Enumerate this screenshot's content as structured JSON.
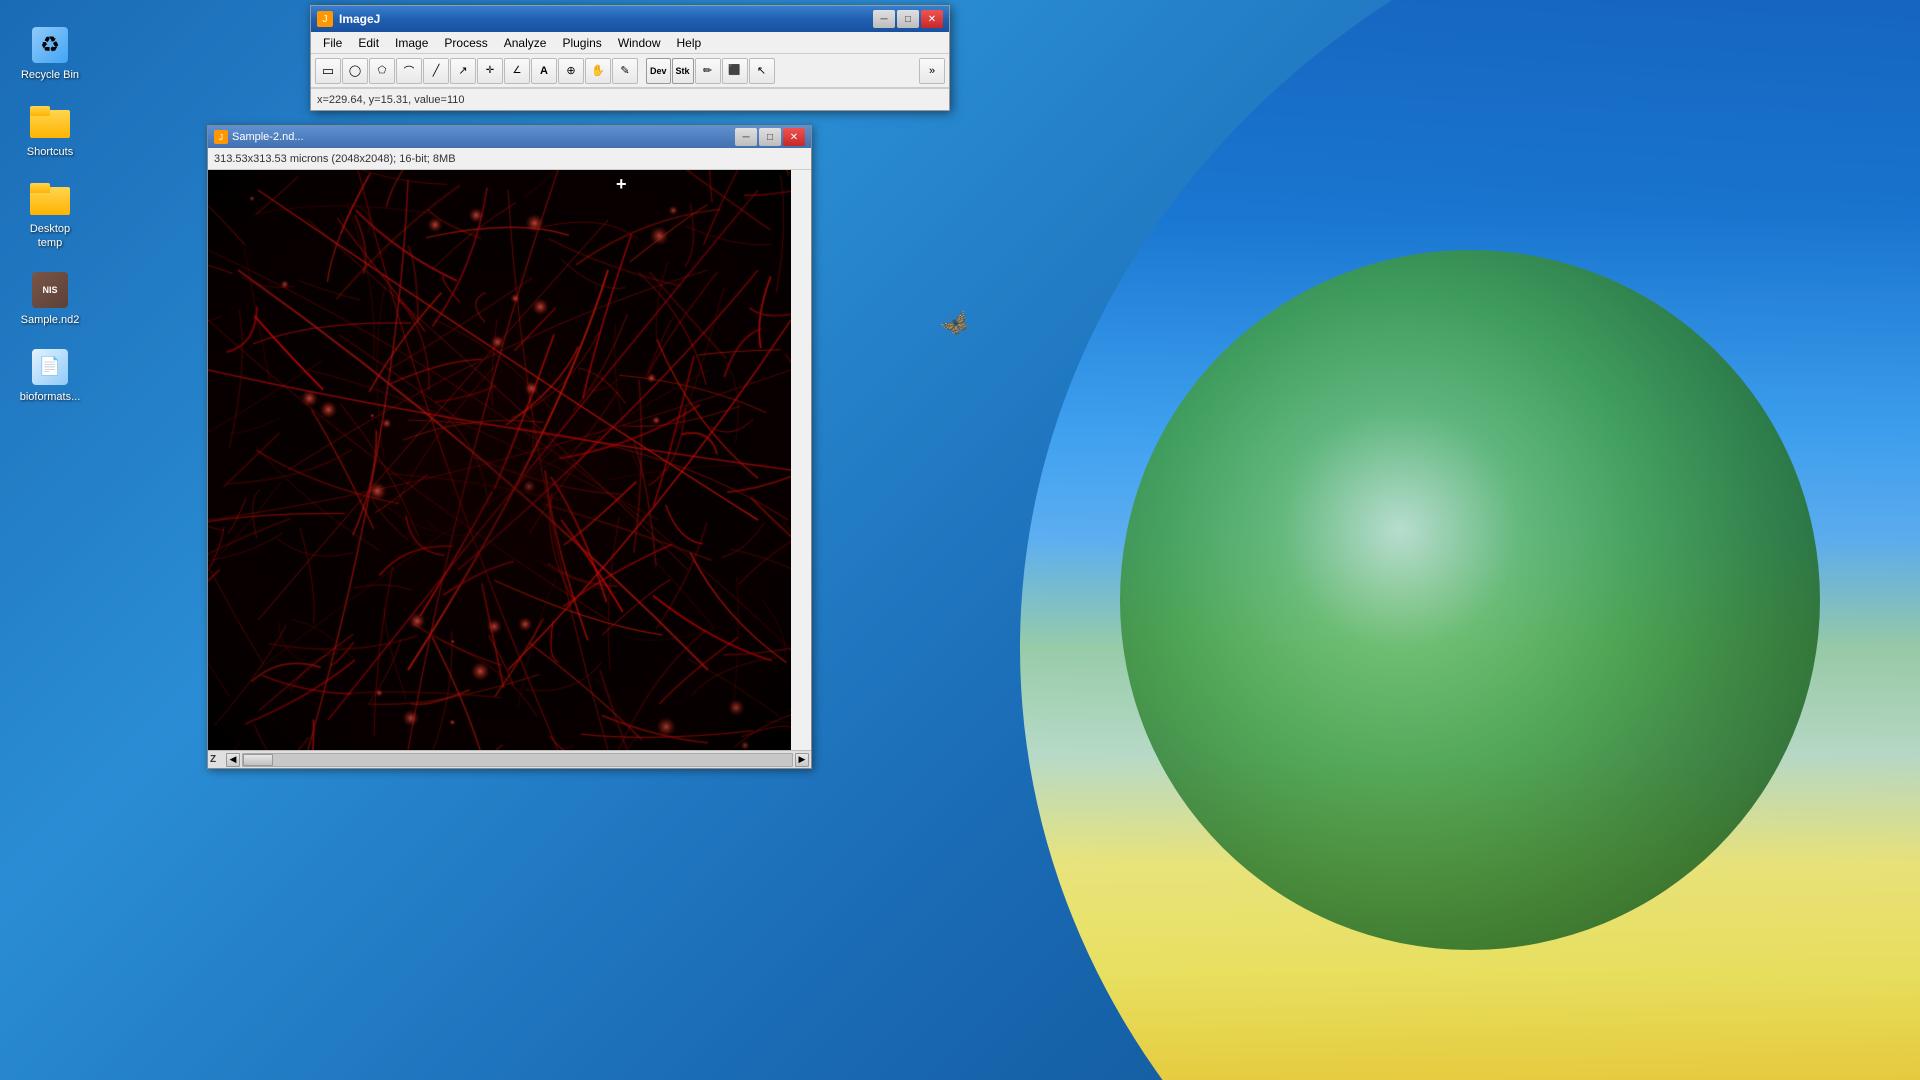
{
  "desktop": {
    "icons": [
      {
        "id": "recycle-bin",
        "label": "Recycle Bin",
        "icon_type": "recycle"
      },
      {
        "id": "shortcuts",
        "label": "Shortcuts",
        "icon_type": "folder"
      },
      {
        "id": "desktop-temp",
        "label": "Desktop\ntemp",
        "icon_type": "folder"
      },
      {
        "id": "sample-nd2",
        "label": "Sample.nd2",
        "icon_type": "nis"
      },
      {
        "id": "bioformats",
        "label": "bioformats...",
        "icon_type": "bioformats"
      }
    ]
  },
  "imagej": {
    "title": "ImageJ",
    "menu": [
      "File",
      "Edit",
      "Image",
      "Process",
      "Analyze",
      "Plugins",
      "Window",
      "Help"
    ],
    "status_text": "x=229.64, y=15.31, value=110",
    "tools": [
      {
        "id": "rect",
        "symbol": "▭",
        "label": "Rectangle"
      },
      {
        "id": "oval",
        "symbol": "◯",
        "label": "Oval"
      },
      {
        "id": "poly",
        "symbol": "⬠",
        "label": "Polygon"
      },
      {
        "id": "freehand",
        "symbol": "⌒",
        "label": "Freehand"
      },
      {
        "id": "line",
        "symbol": "╱",
        "label": "Line"
      },
      {
        "id": "arrow",
        "symbol": "↗",
        "label": "Arrow"
      },
      {
        "id": "cross",
        "symbol": "✛",
        "label": "CrossHair"
      },
      {
        "id": "angle",
        "symbol": "∠",
        "label": "Angle"
      },
      {
        "id": "text",
        "symbol": "A",
        "label": "Text"
      },
      {
        "id": "zoom",
        "symbol": "🔍",
        "label": "Zoom"
      },
      {
        "id": "hand",
        "symbol": "✋",
        "label": "Hand"
      },
      {
        "id": "color",
        "symbol": "✎",
        "label": "Color"
      }
    ],
    "extra_tools": [
      {
        "id": "dev",
        "label": "Dev"
      },
      {
        "id": "stk",
        "label": "Stk"
      },
      {
        "id": "pencil",
        "symbol": "✏"
      },
      {
        "id": "paint",
        "symbol": "⬛"
      },
      {
        "id": "pointer",
        "symbol": "↖"
      }
    ]
  },
  "image_window": {
    "title": "Sample-2.nd...",
    "info": "313.53x313.53 microns (2048x2048); 16-bit; 8MB",
    "scroll_label": "Z",
    "scroll_position": 0
  }
}
